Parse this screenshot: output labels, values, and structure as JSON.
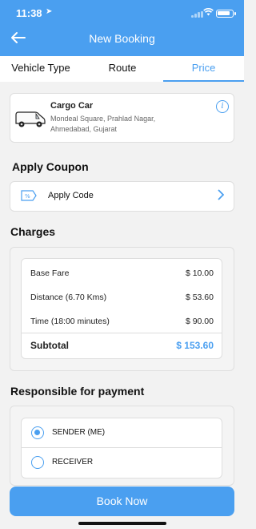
{
  "status": {
    "time": "11:38"
  },
  "header": {
    "title": "New Booking"
  },
  "tabs": [
    {
      "label": "Vehicle Type"
    },
    {
      "label": "Route"
    },
    {
      "label": "Price"
    }
  ],
  "vehicle": {
    "name": "Cargo Car",
    "address": "Mondeal Square, Prahlad Nagar, Ahmedabad, Gujarat"
  },
  "coupon": {
    "section_title": "Apply Coupon",
    "label": "Apply Code"
  },
  "charges": {
    "section_title": "Charges",
    "rows": [
      {
        "label": "Base Fare",
        "value": "$ 10.00"
      },
      {
        "label": "Distance (6.70 Kms)",
        "value": "$ 53.60"
      },
      {
        "label": "Time (18:00 minutes)",
        "value": "$ 90.00"
      }
    ],
    "subtotal": {
      "label": "Subtotal",
      "value": "$ 153.60"
    }
  },
  "payment": {
    "section_title": "Responsible for payment",
    "options": [
      {
        "label": "SENDER (ME)",
        "selected": true
      },
      {
        "label": "RECEIVER",
        "selected": false
      }
    ]
  },
  "footer": {
    "book_label": "Book Now"
  },
  "colors": {
    "accent": "#4a9ff0",
    "background": "#f2f2f2"
  }
}
